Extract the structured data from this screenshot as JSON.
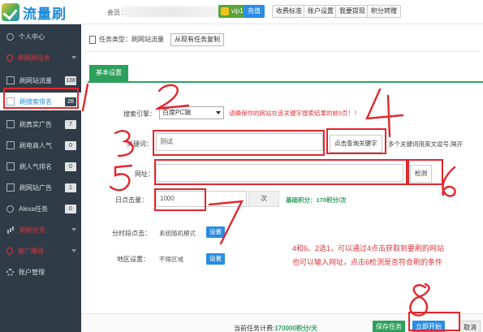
{
  "header": {
    "logo_text": "流量刷",
    "member_label": "会员：",
    "vip": "vip1",
    "recharge": "充值",
    "buttons": [
      "收费标准",
      "账户设置",
      "我要提现",
      "积分转赠"
    ]
  },
  "sidebar": {
    "items": [
      {
        "label": "个人中心",
        "count": "",
        "icon": "person-icon"
      },
      {
        "label": "刷刷刷任务",
        "count": "",
        "icon": "pin-icon",
        "red": true
      },
      {
        "label": "刷网站流量",
        "count": "138",
        "icon": "square-icon"
      },
      {
        "label": "刷搜索排名",
        "count": "28",
        "icon": "square-icon",
        "active": true
      },
      {
        "label": "刷真实广告",
        "count": "7",
        "icon": "square-icon"
      },
      {
        "label": "刷电商人气",
        "count": "0",
        "icon": "square-icon"
      },
      {
        "label": "刷人气排名",
        "count": "0",
        "icon": "square-icon"
      },
      {
        "label": "刷网站广告",
        "count": "1",
        "icon": "square-icon"
      },
      {
        "label": "Alexa任务",
        "count": "0",
        "icon": "circle-icon"
      },
      {
        "label": "刷刷任务",
        "count": "",
        "icon": "bars-icon",
        "red": true
      },
      {
        "label": "推广赚钱",
        "count": "",
        "icon": "pin-icon",
        "red": true
      },
      {
        "label": "账户管理",
        "count": "",
        "icon": "gear-icon"
      }
    ]
  },
  "main": {
    "task_type": "任务类型：刷网站流量",
    "copy_button": "从现有任务复制",
    "tab_basic": "基本设置",
    "engine_label": "搜索引擎：",
    "engine_value": "百度PC端",
    "engine_warning": "请确保你的网站在该关键字搜索结果的前5页！！",
    "keyword_label": "关键词：",
    "keyword_value": "测试",
    "fetch_button": "点击查询关键字",
    "keyword_hint": "多个关键词用英文逗号,隔开",
    "url_label": "网址：",
    "url_value": "",
    "check_button": "检测",
    "daily_label": "日点击量：",
    "daily_value": "1000",
    "daily_unit": "次",
    "base_points": "基础积分：170积分/次",
    "time_label": "分时段点击：",
    "time_value": "系统随机模式",
    "time_button": "设置",
    "region_label": "地区设置：",
    "region_value": "不限区域",
    "region_button": "设置",
    "note_line1": "4和6、2选1，可以通过4点击获取到要刷的网站",
    "note_line2": "也可以输入网址，点击6检测是否符合刷的条件"
  },
  "footer": {
    "cost_prefix": "当前任务计费:",
    "cost_value": "170000积分/天",
    "save_button": "保存任务",
    "start_button": "立即开始",
    "cancel_button": "取消"
  },
  "annotations": {
    "n1": "1",
    "n2": "2",
    "n3": "3",
    "n4": "4",
    "n5": "5",
    "n6": "6",
    "n7": "7",
    "n8": "8",
    "color": "#e3262d"
  },
  "colors": {
    "sidebar_bg": "#2f3b46",
    "accent_green": "#2ea05d",
    "accent_blue": "#2b8de3",
    "warning_red": "#e2343b"
  }
}
